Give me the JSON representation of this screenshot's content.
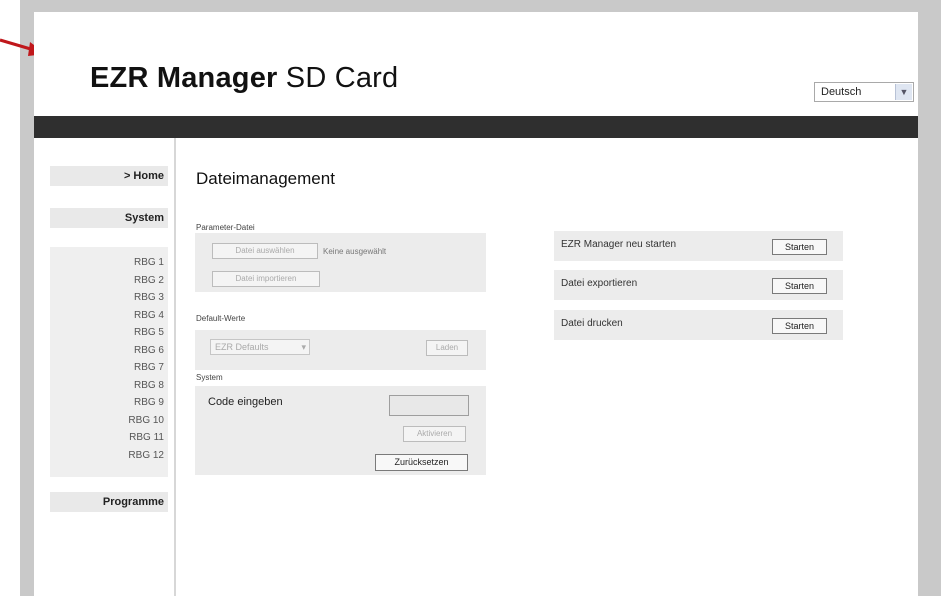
{
  "header": {
    "title_bold": "EZR Manager",
    "title_rest": " SD Card",
    "language": {
      "selected": "Deutsch",
      "icon": "chevron-down-icon"
    }
  },
  "sidebar": {
    "home": "> Home",
    "system": "System",
    "rbg_items": [
      "RBG 1",
      "RBG 2",
      "RBG 3",
      "RBG 4",
      "RBG 5",
      "RBG 6",
      "RBG 7",
      "RBG 8",
      "RBG 9",
      "RBG 10",
      "RBG 11",
      "RBG 12"
    ],
    "programme": "Programme"
  },
  "main": {
    "title": "Dateimanagement",
    "param_file": {
      "label": "Parameter-Datei",
      "choose_button": "Datei auswählen",
      "no_file_text": "Keine ausgewählt",
      "import_button": "Datei importieren"
    },
    "defaults": {
      "label": "Default-Werte",
      "select_value": "EZR Defaults",
      "load_button": "Laden"
    },
    "system": {
      "label": "System",
      "code_label": "Code eingeben",
      "code_value": "",
      "activate_button": "Aktivieren",
      "reset_button": "Zurücksetzen"
    },
    "actions": [
      {
        "label": "EZR Manager neu starten",
        "button": "Starten"
      },
      {
        "label": "Datei exportieren",
        "button": "Starten"
      },
      {
        "label": "Datei drucken",
        "button": "Starten"
      }
    ]
  },
  "colors": {
    "dark_band": "#2f2f2f",
    "frame": "#c9c9c9",
    "arrow": "#c0171b"
  }
}
